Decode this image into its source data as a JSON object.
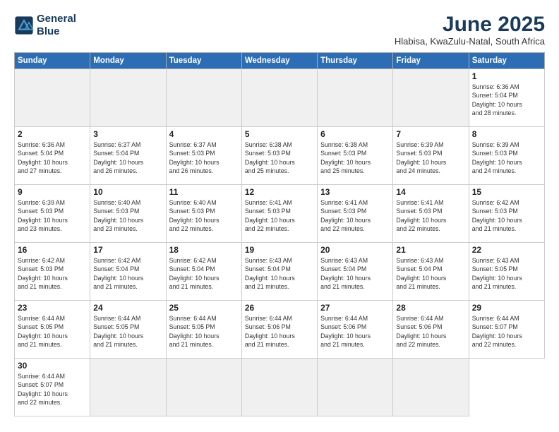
{
  "logo": {
    "line1": "General",
    "line2": "Blue"
  },
  "title": "June 2025",
  "subtitle": "Hlabisa, KwaZulu-Natal, South Africa",
  "headers": [
    "Sunday",
    "Monday",
    "Tuesday",
    "Wednesday",
    "Thursday",
    "Friday",
    "Saturday"
  ],
  "days": [
    {
      "num": "",
      "info": ""
    },
    {
      "num": "",
      "info": ""
    },
    {
      "num": "",
      "info": ""
    },
    {
      "num": "",
      "info": ""
    },
    {
      "num": "",
      "info": ""
    },
    {
      "num": "",
      "info": ""
    },
    {
      "num": "1",
      "info": "Sunrise: 6:36 AM\nSunset: 5:04 PM\nDaylight: 10 hours\nand 28 minutes."
    },
    {
      "num": "2",
      "info": "Sunrise: 6:36 AM\nSunset: 5:04 PM\nDaylight: 10 hours\nand 27 minutes."
    },
    {
      "num": "3",
      "info": "Sunrise: 6:37 AM\nSunset: 5:04 PM\nDaylight: 10 hours\nand 26 minutes."
    },
    {
      "num": "4",
      "info": "Sunrise: 6:37 AM\nSunset: 5:03 PM\nDaylight: 10 hours\nand 26 minutes."
    },
    {
      "num": "5",
      "info": "Sunrise: 6:38 AM\nSunset: 5:03 PM\nDaylight: 10 hours\nand 25 minutes."
    },
    {
      "num": "6",
      "info": "Sunrise: 6:38 AM\nSunset: 5:03 PM\nDaylight: 10 hours\nand 25 minutes."
    },
    {
      "num": "7",
      "info": "Sunrise: 6:39 AM\nSunset: 5:03 PM\nDaylight: 10 hours\nand 24 minutes."
    },
    {
      "num": "8",
      "info": "Sunrise: 6:39 AM\nSunset: 5:03 PM\nDaylight: 10 hours\nand 24 minutes."
    },
    {
      "num": "9",
      "info": "Sunrise: 6:39 AM\nSunset: 5:03 PM\nDaylight: 10 hours\nand 23 minutes."
    },
    {
      "num": "10",
      "info": "Sunrise: 6:40 AM\nSunset: 5:03 PM\nDaylight: 10 hours\nand 23 minutes."
    },
    {
      "num": "11",
      "info": "Sunrise: 6:40 AM\nSunset: 5:03 PM\nDaylight: 10 hours\nand 22 minutes."
    },
    {
      "num": "12",
      "info": "Sunrise: 6:41 AM\nSunset: 5:03 PM\nDaylight: 10 hours\nand 22 minutes."
    },
    {
      "num": "13",
      "info": "Sunrise: 6:41 AM\nSunset: 5:03 PM\nDaylight: 10 hours\nand 22 minutes."
    },
    {
      "num": "14",
      "info": "Sunrise: 6:41 AM\nSunset: 5:03 PM\nDaylight: 10 hours\nand 22 minutes."
    },
    {
      "num": "15",
      "info": "Sunrise: 6:42 AM\nSunset: 5:03 PM\nDaylight: 10 hours\nand 21 minutes."
    },
    {
      "num": "16",
      "info": "Sunrise: 6:42 AM\nSunset: 5:03 PM\nDaylight: 10 hours\nand 21 minutes."
    },
    {
      "num": "17",
      "info": "Sunrise: 6:42 AM\nSunset: 5:04 PM\nDaylight: 10 hours\nand 21 minutes."
    },
    {
      "num": "18",
      "info": "Sunrise: 6:42 AM\nSunset: 5:04 PM\nDaylight: 10 hours\nand 21 minutes."
    },
    {
      "num": "19",
      "info": "Sunrise: 6:43 AM\nSunset: 5:04 PM\nDaylight: 10 hours\nand 21 minutes."
    },
    {
      "num": "20",
      "info": "Sunrise: 6:43 AM\nSunset: 5:04 PM\nDaylight: 10 hours\nand 21 minutes."
    },
    {
      "num": "21",
      "info": "Sunrise: 6:43 AM\nSunset: 5:04 PM\nDaylight: 10 hours\nand 21 minutes."
    },
    {
      "num": "22",
      "info": "Sunrise: 6:43 AM\nSunset: 5:05 PM\nDaylight: 10 hours\nand 21 minutes."
    },
    {
      "num": "23",
      "info": "Sunrise: 6:44 AM\nSunset: 5:05 PM\nDaylight: 10 hours\nand 21 minutes."
    },
    {
      "num": "24",
      "info": "Sunrise: 6:44 AM\nSunset: 5:05 PM\nDaylight: 10 hours\nand 21 minutes."
    },
    {
      "num": "25",
      "info": "Sunrise: 6:44 AM\nSunset: 5:05 PM\nDaylight: 10 hours\nand 21 minutes."
    },
    {
      "num": "26",
      "info": "Sunrise: 6:44 AM\nSunset: 5:06 PM\nDaylight: 10 hours\nand 21 minutes."
    },
    {
      "num": "27",
      "info": "Sunrise: 6:44 AM\nSunset: 5:06 PM\nDaylight: 10 hours\nand 21 minutes."
    },
    {
      "num": "28",
      "info": "Sunrise: 6:44 AM\nSunset: 5:06 PM\nDaylight: 10 hours\nand 22 minutes."
    },
    {
      "num": "29",
      "info": "Sunrise: 6:44 AM\nSunset: 5:07 PM\nDaylight: 10 hours\nand 22 minutes."
    },
    {
      "num": "30",
      "info": "Sunrise: 6:44 AM\nSunset: 5:07 PM\nDaylight: 10 hours\nand 22 minutes."
    },
    {
      "num": "",
      "info": ""
    },
    {
      "num": "",
      "info": ""
    },
    {
      "num": "",
      "info": ""
    },
    {
      "num": "",
      "info": ""
    },
    {
      "num": "",
      "info": ""
    }
  ]
}
